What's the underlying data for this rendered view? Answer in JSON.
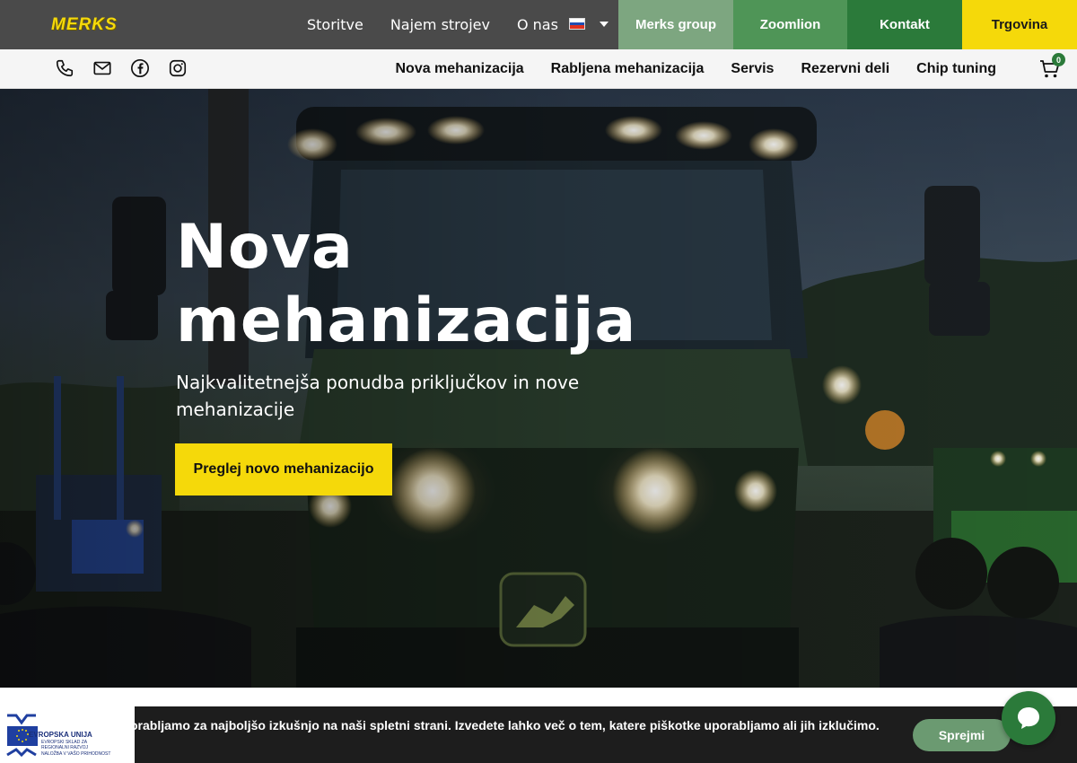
{
  "brand": {
    "logo_text": "MERKS"
  },
  "topnav": {
    "items": [
      "Storitve",
      "Najem strojev",
      "O nas"
    ],
    "language": "sl"
  },
  "top_tiles": [
    {
      "label": "Merks group",
      "color": "#7da680"
    },
    {
      "label": "Zoomlion",
      "color": "#4f9557"
    },
    {
      "label": "Kontakt",
      "color": "#2b7a3a"
    },
    {
      "label": "Trgovina",
      "color": "#f5d90a"
    }
  ],
  "social_icons": [
    "phone-icon",
    "mail-icon",
    "facebook-icon",
    "instagram-icon"
  ],
  "mainnav": {
    "items": [
      "Nova mehanizacija",
      "Rabljena mehanizacija",
      "Servis",
      "Rezervni deli",
      "Chip tuning"
    ]
  },
  "cart": {
    "count": "0"
  },
  "hero": {
    "title_line1": "Nova",
    "title_line2": "mehanizacija",
    "subtitle": "Najkvalitetnejša ponudba priključkov in nove mehanizacije",
    "button": "Preglej novo mehanizacijo"
  },
  "cookie": {
    "text": "orabljamo za najboljšo izkušnjo na naši spletni strani. Izvedete lahko več o tem, katere piškotke uporabljamo ali jih izklučimo.",
    "accept": "Sprejmi"
  },
  "eu_badge": {
    "line1": "EVROPSKA UNIJA",
    "line2": "EVROPSKI SKLAD ZA REGIONALNI RAZVOJ",
    "line3": "NALOŽBA V VAŠO PRIHODNOST"
  },
  "colors": {
    "accent_yellow": "#f5d90a",
    "brand_green": "#2b7a3a",
    "topbar": "#4a4a4a"
  }
}
